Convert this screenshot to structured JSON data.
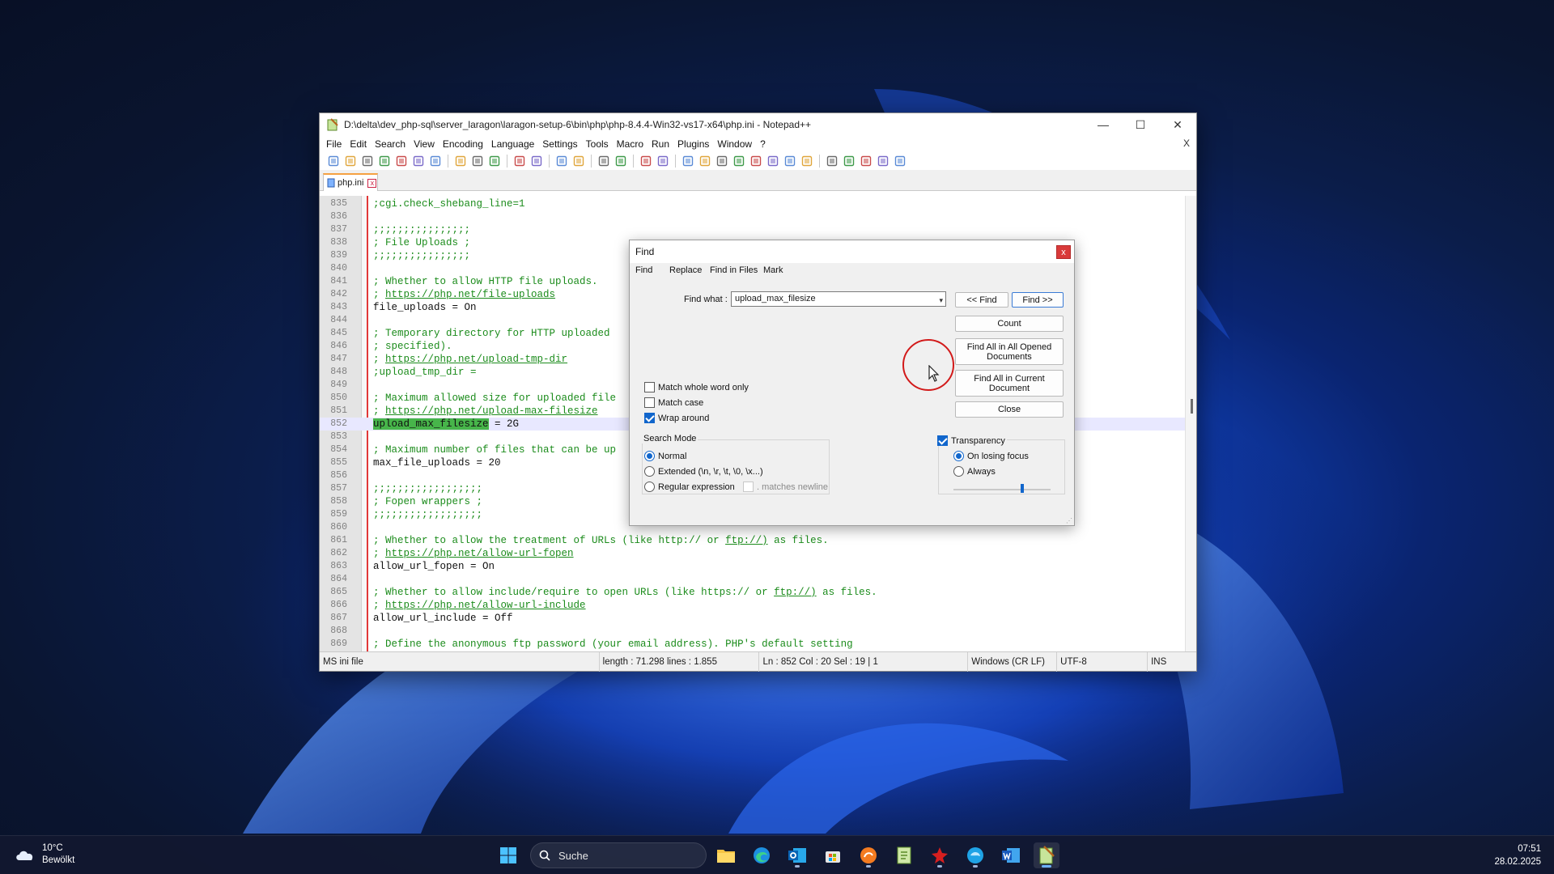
{
  "window": {
    "title": "D:\\delta\\dev_php-sql\\server_laragon\\laragon-setup-6\\bin\\php\\php-8.4.4-Win32-vs17-x64\\php.ini - Notepad++",
    "controls": {
      "minimize": "—",
      "maximize": "☐",
      "close": "✕"
    }
  },
  "menu": {
    "items": [
      "File",
      "Edit",
      "Search",
      "View",
      "Encoding",
      "Language",
      "Settings",
      "Tools",
      "Macro",
      "Run",
      "Plugins",
      "Window",
      "?"
    ],
    "close": "X"
  },
  "toolbar": {
    "icons": [
      "new-file-icon",
      "open-file-icon",
      "save-icon",
      "save-all-icon",
      "close-icon",
      "close-all-icon",
      "print-icon",
      "cut-icon",
      "copy-icon",
      "paste-icon",
      "undo-icon",
      "redo-icon",
      "find-icon",
      "replace-icon",
      "zoom-in-icon",
      "zoom-out-icon",
      "sync-vertical-icon",
      "sync-horizontal-icon",
      "word-wrap-icon",
      "all-chars-icon",
      "indent-guide-icon",
      "lang-define-icon",
      "doc-map-icon",
      "function-list-icon",
      "folder-workspace-icon",
      "monitoring-icon",
      "record-macro-icon",
      "stop-record-icon",
      "play-macro-icon",
      "run-macro-multiple-icon",
      "save-macro-icon"
    ]
  },
  "tab": {
    "label": "php.ini",
    "close": "x"
  },
  "editor": {
    "current_line": "852",
    "lines": [
      {
        "n": "835",
        "parts": [
          {
            "t": ";cgi.check_shebang_line=1",
            "k": "comment"
          }
        ]
      },
      {
        "n": "836",
        "parts": []
      },
      {
        "n": "837",
        "parts": [
          {
            "t": ";;;;;;;;;;;;;;;;",
            "k": "comment"
          }
        ]
      },
      {
        "n": "838",
        "parts": [
          {
            "t": "; File Uploads ;",
            "k": "comment"
          }
        ]
      },
      {
        "n": "839",
        "parts": [
          {
            "t": ";;;;;;;;;;;;;;;;",
            "k": "comment"
          }
        ]
      },
      {
        "n": "840",
        "parts": []
      },
      {
        "n": "841",
        "parts": [
          {
            "t": "; Whether to allow HTTP file uploads.",
            "k": "comment"
          }
        ]
      },
      {
        "n": "842",
        "parts": [
          {
            "t": "; ",
            "k": "comment"
          },
          {
            "t": "https://php.net/file-uploads",
            "k": "link"
          }
        ]
      },
      {
        "n": "843",
        "parts": [
          {
            "t": "file_uploads = On",
            "k": "default"
          }
        ]
      },
      {
        "n": "844",
        "parts": []
      },
      {
        "n": "845",
        "parts": [
          {
            "t": "; Temporary directory for HTTP uploaded",
            "k": "comment"
          }
        ]
      },
      {
        "n": "846",
        "parts": [
          {
            "t": "; specified).",
            "k": "comment"
          }
        ]
      },
      {
        "n": "847",
        "parts": [
          {
            "t": "; ",
            "k": "comment"
          },
          {
            "t": "https://php.net/upload-tmp-dir",
            "k": "link"
          }
        ]
      },
      {
        "n": "848",
        "parts": [
          {
            "t": ";upload_tmp_dir =",
            "k": "comment"
          }
        ]
      },
      {
        "n": "849",
        "parts": []
      },
      {
        "n": "850",
        "parts": [
          {
            "t": "; Maximum allowed size for uploaded file",
            "k": "comment"
          }
        ]
      },
      {
        "n": "851",
        "parts": [
          {
            "t": "; ",
            "k": "comment"
          },
          {
            "t": "https://php.net/upload-max-filesize",
            "k": "link"
          }
        ]
      },
      {
        "n": "852",
        "parts": [
          {
            "t": "upload_max_filesize",
            "k": "hit"
          },
          {
            "t": " = 2G",
            "k": "default"
          }
        ]
      },
      {
        "n": "853",
        "parts": []
      },
      {
        "n": "854",
        "parts": [
          {
            "t": "; Maximum number of files that can be up",
            "k": "comment"
          }
        ]
      },
      {
        "n": "855",
        "parts": [
          {
            "t": "max_file_uploads = 20",
            "k": "default"
          }
        ]
      },
      {
        "n": "856",
        "parts": []
      },
      {
        "n": "857",
        "parts": [
          {
            "t": ";;;;;;;;;;;;;;;;;;",
            "k": "comment"
          }
        ]
      },
      {
        "n": "858",
        "parts": [
          {
            "t": "; Fopen wrappers ;",
            "k": "comment"
          }
        ]
      },
      {
        "n": "859",
        "parts": [
          {
            "t": ";;;;;;;;;;;;;;;;;;",
            "k": "comment"
          }
        ]
      },
      {
        "n": "860",
        "parts": []
      },
      {
        "n": "861",
        "parts": [
          {
            "t": "; Whether to allow the treatment of URLs (like http:// or ",
            "k": "comment"
          },
          {
            "t": "ftp://)",
            "k": "link"
          },
          {
            "t": " as files.",
            "k": "comment"
          }
        ]
      },
      {
        "n": "862",
        "parts": [
          {
            "t": "; ",
            "k": "comment"
          },
          {
            "t": "https://php.net/allow-url-fopen",
            "k": "link"
          }
        ]
      },
      {
        "n": "863",
        "parts": [
          {
            "t": "allow_url_fopen = On",
            "k": "default"
          }
        ]
      },
      {
        "n": "864",
        "parts": []
      },
      {
        "n": "865",
        "parts": [
          {
            "t": "; Whether to allow include/require to open URLs (like https:// or ",
            "k": "comment"
          },
          {
            "t": "ftp://)",
            "k": "link"
          },
          {
            "t": " as files.",
            "k": "comment"
          }
        ]
      },
      {
        "n": "866",
        "parts": [
          {
            "t": "; ",
            "k": "comment"
          },
          {
            "t": "https://php.net/allow-url-include",
            "k": "link"
          }
        ]
      },
      {
        "n": "867",
        "parts": [
          {
            "t": "allow_url_include = Off",
            "k": "default"
          }
        ]
      },
      {
        "n": "868",
        "parts": []
      },
      {
        "n": "869",
        "parts": [
          {
            "t": "; Define the anonymous ftp password (your email address). PHP's default setting",
            "k": "comment"
          }
        ]
      }
    ]
  },
  "status": {
    "lang": "MS ini file",
    "length": "length : 71.298    lines : 1.855",
    "pos": "Ln : 852    Col : 20    Sel : 19 | 1",
    "eol": "Windows (CR LF)",
    "encoding": "UTF-8",
    "mode": "INS"
  },
  "find": {
    "title": "Find",
    "close": "x",
    "tabs": [
      "Find",
      "Replace",
      "Find in Files",
      "Mark"
    ],
    "find_label": "Find what :",
    "find_value": "upload_max_filesize",
    "dropdown": "▾",
    "buttons": {
      "prev": "<< Find",
      "next": "Find >>",
      "count": "Count",
      "find_all_opened": "Find All in All Opened Documents",
      "find_all_current": "Find All in Current Document",
      "close": "Close"
    },
    "options": {
      "whole_word": {
        "label": "Match whole word only",
        "checked": false
      },
      "match_case": {
        "label": "Match case",
        "checked": false
      },
      "wrap_around": {
        "label": "Wrap around",
        "checked": true
      }
    },
    "search_mode": {
      "title": "Search Mode",
      "normal": "Normal",
      "extended": "Extended (\\n, \\r, \\t, \\0, \\x...)",
      "regex": "Regular expression",
      "matches_newline": ". matches newline",
      "selected": "normal"
    },
    "transparency": {
      "label": "Transparency",
      "checked": true,
      "on_losing_focus": "On losing focus",
      "always": "Always",
      "selected": "on_losing_focus",
      "level": 0.6
    }
  },
  "taskbar": {
    "weather_temp": "10°C",
    "weather_desc": "Bewölkt",
    "search_placeholder": "Suche",
    "time": "07:51",
    "date": "28.02.2025",
    "apps": [
      "windows-start-icon",
      "file-explorer-icon",
      "edge-icon",
      "outlook-icon",
      "store-icon",
      "app-orange-icon",
      "notepad-green-icon",
      "app-red-icon",
      "app-blue-icon",
      "word-icon",
      "notepadpp-icon"
    ]
  }
}
